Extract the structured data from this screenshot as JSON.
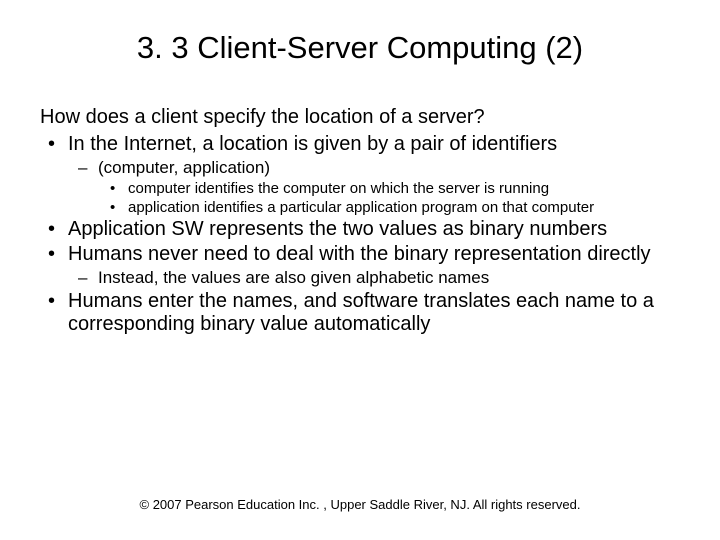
{
  "title": "3. 3 Client-Server Computing (2)",
  "intro": "How does a client specify the location of a server?",
  "bullets": {
    "b1": "In the Internet, a location is given by a pair of identifiers",
    "b1_1": "(computer, application)",
    "b1_1_1": "computer  identifies the computer on which the server is running",
    "b1_1_2": "application  identifies a particular application program on that computer",
    "b2": "Application SW represents the two values as binary numbers",
    "b3": "Humans never need to deal with the binary representation directly",
    "b3_1": "Instead, the values are also given alphabetic names",
    "b4": "Humans enter the names, and software translates each name to a corresponding binary value automatically"
  },
  "footer": "© 2007 Pearson Education Inc. , Upper Saddle River, NJ. All rights reserved."
}
